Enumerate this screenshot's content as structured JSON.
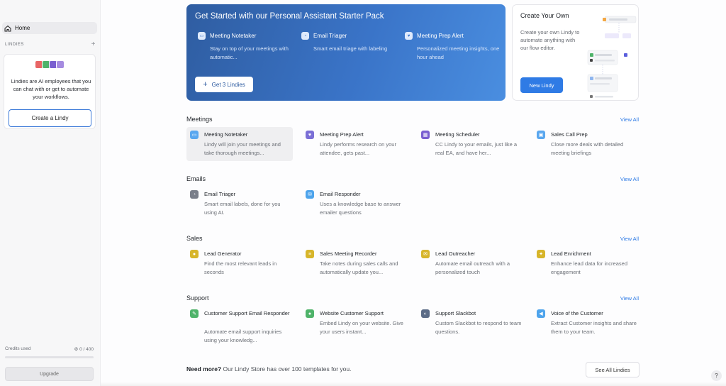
{
  "sidebar": {
    "home_label": "Home",
    "lindies_label": "LINDIES",
    "add_icon": "plus-icon",
    "promo_text": "Lindies are AI employees that you can chat with or get to automate your workflows.",
    "promo_button": "Create a Lindy",
    "credits_label": "Credits used",
    "credits_value": "0 / 400",
    "upgrade_label": "Upgrade"
  },
  "starter": {
    "title": "Get Started with our Personal Assistant Starter Pack",
    "items": [
      {
        "title": "Meeting Notetaker",
        "desc": "Stay on top of your meetings with automatic...",
        "icon": "meeting-icon"
      },
      {
        "title": "Email Triager",
        "desc": "Smart email triage with labeling",
        "icon": "email-icon"
      },
      {
        "title": "Meeting Prep Alert",
        "desc": "Personalized meeting insights, one hour ahead",
        "icon": "heart-icon"
      }
    ],
    "button": "Get 3 Lindies"
  },
  "create_own": {
    "title": "Create Your Own",
    "desc": "Create your own Lindy to automate anything with our flow editor.",
    "button": "New Lindy"
  },
  "sections": [
    {
      "title": "Meetings",
      "view_all": "View All",
      "cards": [
        {
          "title": "Meeting Notetaker",
          "desc": "Lindy will join your meetings and take thorough meetings...",
          "icon": "video-icon",
          "color": "#5aa7ef"
        },
        {
          "title": "Meeting Prep Alert",
          "desc": "Lindy performs research on your attendee, gets past...",
          "icon": "heart-icon",
          "color": "#7b6fd6"
        },
        {
          "title": "Meeting Scheduler",
          "desc": "CC Lindy to your emails, just like a real EA, and have her...",
          "icon": "calendar-icon",
          "color": "#7a5fd0"
        },
        {
          "title": "Sales Call Prep",
          "desc": "Close more deals with detailed meeting briefings",
          "icon": "briefcase-icon",
          "color": "#5aa7ef"
        }
      ]
    },
    {
      "title": "Emails",
      "view_all": "View All",
      "cards": [
        {
          "title": "Email Triager",
          "desc": "Smart email labels, done for you using AI.",
          "icon": "pie-icon",
          "color": "#7a7f8a"
        },
        {
          "title": "Email Responder",
          "desc": "Uses a knowledge base to answer emailer questions",
          "icon": "mail-icon",
          "color": "#4ea4ec"
        }
      ]
    },
    {
      "title": "Sales",
      "view_all": "View All",
      "cards": [
        {
          "title": "Lead Generator",
          "desc": "Find the most relevant leads in seconds",
          "icon": "users-icon",
          "color": "#d7b52a"
        },
        {
          "title": "Sales Meeting Recorder",
          "desc": "Take notes during sales calls and automatically update you...",
          "icon": "waveform-icon",
          "color": "#d7b52a"
        },
        {
          "title": "Lead Outreacher",
          "desc": "Automate email outreach with a personalized touch",
          "icon": "mail-icon",
          "color": "#d7b52a"
        },
        {
          "title": "Lead Enrichment",
          "desc": "Enhance lead data for increased engagement",
          "icon": "sparkle-icon",
          "color": "#d7b52a"
        }
      ]
    },
    {
      "title": "Support",
      "view_all": "View All",
      "cards": [
        {
          "title": "Customer Support Email Responder",
          "desc": "Automate email support inquiries using your knowledg...",
          "icon": "pen-icon",
          "color": "#4fb36a"
        },
        {
          "title": "Website Customer Support",
          "desc": "Embed Lindy on your website. Give your users instant...",
          "icon": "chat-icon",
          "color": "#4fb36a"
        },
        {
          "title": "Support Slackbot",
          "desc": "Custom Slackbot to respond to team questions.",
          "icon": "slack-icon",
          "color": "#5b6b86"
        },
        {
          "title": "Voice of the Customer",
          "desc": "Extract Customer insights and share them to your team.",
          "icon": "megaphone-icon",
          "color": "#4ea4ec"
        }
      ]
    }
  ],
  "footer": {
    "need_more_bold": "Need more?",
    "need_more_text": "Our Lindy Store has over 100 templates for you.",
    "see_all": "See All Lindies"
  },
  "help_label": "?"
}
